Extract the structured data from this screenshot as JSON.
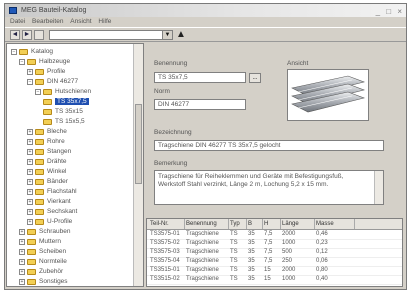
{
  "window": {
    "title": "MEG Bauteil-Katalog",
    "controls": "_ □ ×"
  },
  "menubar": [
    "Datei",
    "Bearbeiten",
    "Ansicht",
    "Hilfe"
  ],
  "toolbar": {
    "back_icon": "back-arrow-icon",
    "forward_icon": "forward-arrow-icon",
    "path_value": "",
    "up_glyph": "▲"
  },
  "tree": {
    "items": [
      {
        "label": "Katalog",
        "level": 0,
        "toggle": "−",
        "selected": false
      },
      {
        "label": "Halbzeuge",
        "level": 1,
        "toggle": "−",
        "selected": false
      },
      {
        "label": "Profile",
        "level": 2,
        "toggle": "+",
        "selected": false
      },
      {
        "label": "DIN 46277",
        "level": 2,
        "toggle": "−",
        "selected": false
      },
      {
        "label": "Hutschienen",
        "level": 3,
        "toggle": "−",
        "selected": false
      },
      {
        "label": "TS 35x7,5",
        "level": 4,
        "toggle": "",
        "selected": true
      },
      {
        "label": "TS 35x15",
        "level": 4,
        "toggle": "",
        "selected": false
      },
      {
        "label": "TS 15x5,5",
        "level": 4,
        "toggle": "",
        "selected": false
      },
      {
        "label": "Bleche",
        "level": 2,
        "toggle": "+",
        "selected": false
      },
      {
        "label": "Rohre",
        "level": 2,
        "toggle": "+",
        "selected": false
      },
      {
        "label": "Stangen",
        "level": 2,
        "toggle": "+",
        "selected": false
      },
      {
        "label": "Drähte",
        "level": 2,
        "toggle": "+",
        "selected": false
      },
      {
        "label": "Winkel",
        "level": 2,
        "toggle": "+",
        "selected": false
      },
      {
        "label": "Bänder",
        "level": 2,
        "toggle": "+",
        "selected": false
      },
      {
        "label": "Flachstahl",
        "level": 2,
        "toggle": "+",
        "selected": false
      },
      {
        "label": "Vierkant",
        "level": 2,
        "toggle": "+",
        "selected": false
      },
      {
        "label": "Sechskant",
        "level": 2,
        "toggle": "+",
        "selected": false
      },
      {
        "label": "U-Profile",
        "level": 2,
        "toggle": "+",
        "selected": false
      },
      {
        "label": "Schrauben",
        "level": 1,
        "toggle": "+",
        "selected": false
      },
      {
        "label": "Muttern",
        "level": 1,
        "toggle": "+",
        "selected": false
      },
      {
        "label": "Scheiben",
        "level": 1,
        "toggle": "+",
        "selected": false
      },
      {
        "label": "Normteile",
        "level": 1,
        "toggle": "+",
        "selected": false
      },
      {
        "label": "Zubehör",
        "level": 1,
        "toggle": "+",
        "selected": false
      },
      {
        "label": "Sonstiges",
        "level": 1,
        "toggle": "+",
        "selected": false
      }
    ]
  },
  "detail": {
    "name_label": "Benennung",
    "name_value": "TS 35x7,5",
    "norm_label": "Norm",
    "norm_value": "DIN 46277",
    "browse_label": "...",
    "preview_label": "Ansicht",
    "desc_label": "Bezeichnung",
    "desc_value": "Tragschiene DIN 46277 TS 35x7,5 gelocht",
    "remark_label": "Bemerkung",
    "remark_value": "Tragschiene für Reiheklemmen und Geräte mit Befestigungsfuß, Werkstoff Stahl verzinkt, Länge 2 m, Lochung 5,2 x 15 mm."
  },
  "table": {
    "headers": [
      "Teil-Nr.",
      "Benennung",
      "Typ",
      "B",
      "H",
      "Länge",
      "Masse"
    ],
    "rows": [
      [
        "TS3575-01",
        "Tragschiene",
        "TS",
        "35",
        "7,5",
        "2000",
        "0,46"
      ],
      [
        "TS3575-02",
        "Tragschiene",
        "TS",
        "35",
        "7,5",
        "1000",
        "0,23"
      ],
      [
        "TS3575-03",
        "Tragschiene",
        "TS",
        "35",
        "7,5",
        "500",
        "0,12"
      ],
      [
        "TS3575-04",
        "Tragschiene",
        "TS",
        "35",
        "7,5",
        "250",
        "0,06"
      ],
      [
        "TS3515-01",
        "Tragschiene",
        "TS",
        "35",
        "15",
        "2000",
        "0,80"
      ],
      [
        "TS3515-02",
        "Tragschiene",
        "TS",
        "35",
        "15",
        "1000",
        "0,40"
      ]
    ]
  },
  "colors": {
    "selection": "#1f4fb0",
    "folder": "#f2cf55",
    "chrome": "#d4d0c8"
  }
}
